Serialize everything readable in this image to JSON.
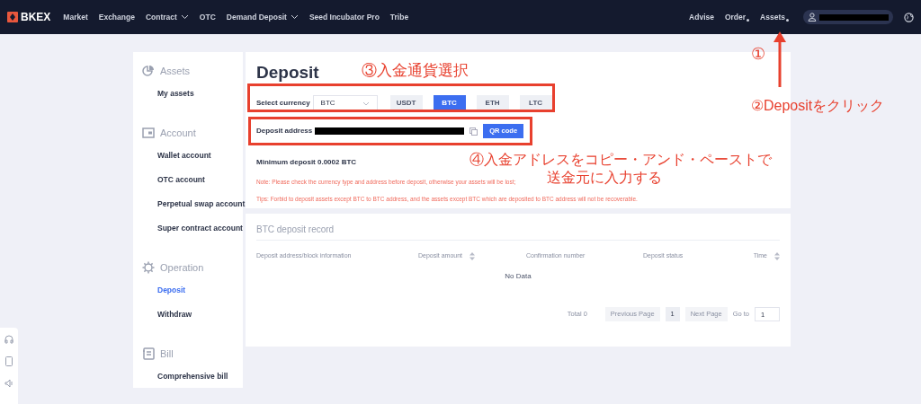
{
  "nav": {
    "logo": "BKEX",
    "items": [
      {
        "label": "Market",
        "dropdown": false
      },
      {
        "label": "Exchange",
        "dropdown": false
      },
      {
        "label": "Contract",
        "dropdown": true
      },
      {
        "label": "OTC",
        "dropdown": false
      },
      {
        "label": "Demand Deposit",
        "dropdown": true
      },
      {
        "label": "Seed Incubator Pro",
        "dropdown": false
      },
      {
        "label": "Tribe",
        "dropdown": false
      }
    ],
    "right_items": [
      {
        "label": "Advise",
        "dropdown": false
      },
      {
        "label": "Order",
        "dropdown": true
      },
      {
        "label": "Assets",
        "dropdown": true
      }
    ]
  },
  "sidebar": [
    {
      "title": "Assets",
      "items": [
        {
          "label": "My assets",
          "selected": false
        }
      ]
    },
    {
      "title": "Account",
      "items": [
        {
          "label": "Wallet account",
          "selected": false
        },
        {
          "label": "OTC account",
          "selected": false
        },
        {
          "label": "Perpetual swap account",
          "selected": false
        },
        {
          "label": "Super contract account",
          "selected": false
        }
      ]
    },
    {
      "title": "Operation",
      "items": [
        {
          "label": "Deposit",
          "selected": true
        },
        {
          "label": "Withdraw",
          "selected": false
        }
      ]
    },
    {
      "title": "Bill",
      "items": [
        {
          "label": "Comprehensive bill",
          "selected": false
        }
      ]
    }
  ],
  "deposit": {
    "title": "Deposit",
    "currency_label": "Select currency",
    "currency_value": "BTC",
    "currencies": [
      {
        "label": "USDT",
        "selected": false
      },
      {
        "label": "BTC",
        "selected": true
      },
      {
        "label": "ETH",
        "selected": false
      },
      {
        "label": "LTC",
        "selected": false
      }
    ],
    "address_label": "Deposit address",
    "qr_button": "QR code",
    "minimum": "Minimum deposit 0.0002 BTC",
    "note": "Note: Please check the currency type and address before deposit, otherwise your assets will be lost;",
    "tips": "Tips: Forbid to deposit assets except BTC to BTC address, and the assets except BTC which are deposited to BTC address will not be recoverable."
  },
  "record": {
    "title": "BTC deposit record",
    "columns": [
      {
        "label": "Deposit address/block information",
        "sortable": false
      },
      {
        "label": "Deposit amount",
        "sortable": true
      },
      {
        "label": "Confirmation number",
        "sortable": false
      },
      {
        "label": "Deposit status",
        "sortable": false
      },
      {
        "label": "Time",
        "sortable": true
      }
    ],
    "empty": "No Data",
    "total": "Total 0",
    "prev": "Previous Page",
    "page": "1",
    "next": "Next Page",
    "goto_label": "Go to",
    "goto_value": "1"
  },
  "annotations": {
    "step1": "①",
    "step2": "②Depositをクリック",
    "step3": "③入金通貨選択",
    "step4": [
      "④入金アドレスをコピー・アンド・ペーストで",
      "送金元に入力する"
    ]
  }
}
